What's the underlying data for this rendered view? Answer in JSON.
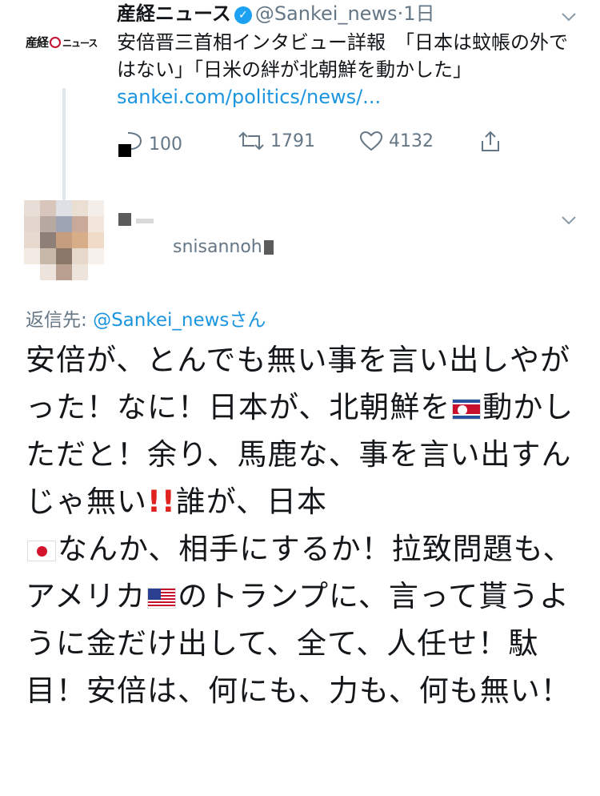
{
  "quoted_tweet": {
    "account_logo_text": "産経ニュース",
    "display_name": "産経ニュース",
    "handle": "@Sankei_news",
    "separator": "·",
    "time": "1日",
    "text": "安倍晋三首相インタビュー詳報　「日本は蚊帳の外ではない」「日米の絆が北朝鮮を動かした」",
    "link": "sankei.com/politics/news/...",
    "replies": "100",
    "retweets": "1791",
    "likes": "4132"
  },
  "reply_tweet": {
    "handle_mirrored": "snisannoh",
    "reply_to_prefix": "返信先: ",
    "reply_to_handle": "@Sankei_news",
    "reply_to_suffix": "さん",
    "body": {
      "p1": "安倍が、とんでも無い事を言い出しやがった！なに！日本が、北朝鮮を",
      "p2": "動かしただと！余り、馬鹿な、事を言い出すんじゃ無い",
      "bang": "!!",
      "p3": "誰が、日本",
      "p4": "なんか、相手にするか！拉致問題も、アメリカ",
      "p5": "のトランプに、言って貰うように金だけ出して、全て、人任せ！駄目！安倍は、何にも、力も、何も無い！"
    }
  },
  "colors": {
    "link": "#1b95e0",
    "muted": "#657786",
    "text": "#14171a",
    "verified": "#1da1f2"
  },
  "icons": [
    "verified-badge-icon",
    "chevron-down-icon",
    "reply-icon",
    "retweet-icon",
    "like-icon",
    "share-icon",
    "flag-north-korea-icon",
    "flag-japan-icon",
    "flag-usa-icon"
  ]
}
